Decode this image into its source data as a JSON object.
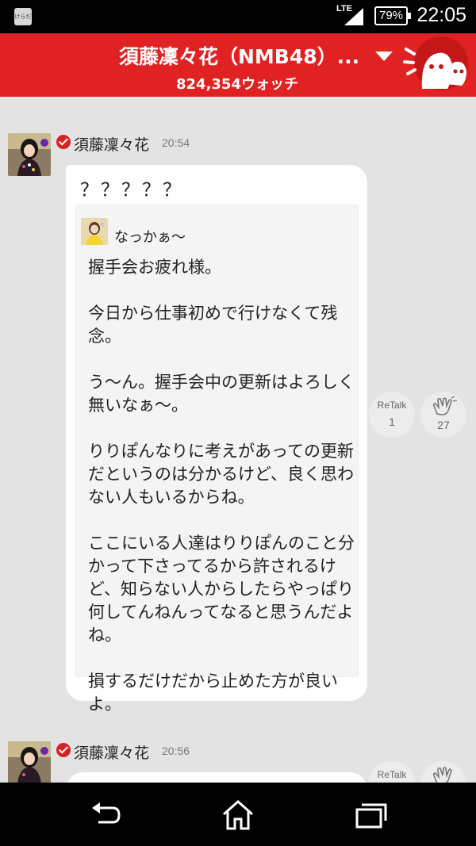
{
  "status_bar": {
    "app_icon": "けらだ",
    "network": "LTE",
    "battery": "79%",
    "time": "22:05"
  },
  "header": {
    "title": "須藤凜々花（NMB48）...",
    "watch_count": "824,354ウォッチ",
    "accent_color": "#e02222",
    "icons": [
      "dropdown-caret-icon",
      "mascot-icon"
    ]
  },
  "messages": [
    {
      "author": "須藤凜々花",
      "time": "20:54",
      "text": "？？？？？",
      "quote": {
        "name": "なっかぁ～",
        "body": "握手会お疲れ様。\n\n今日から仕事初めで行けなくて残念。\n\nう～ん。握手会中の更新はよろしく無いなぁ～。\n\nりりぽんなりに考えがあっての更新だというのは分かるけど、良く思わない人もいるからね。\n\nここにいる人達はりりぽんのこと分かって下さってるから許されるけど、知らない人からしたらやっぱり何してんねんってなると思うんだよね。\n\n損するだけだから止めた方が良いよ。"
      },
      "retalk_label": "ReTalk",
      "retalk_count": "1",
      "clap_count": "27"
    },
    {
      "author": "須藤凜々花",
      "time": "20:56",
      "retalk_label": "ReTalk"
    }
  ],
  "nav_bar": {
    "icons": [
      "back-icon",
      "home-icon",
      "recent-apps-icon"
    ]
  }
}
